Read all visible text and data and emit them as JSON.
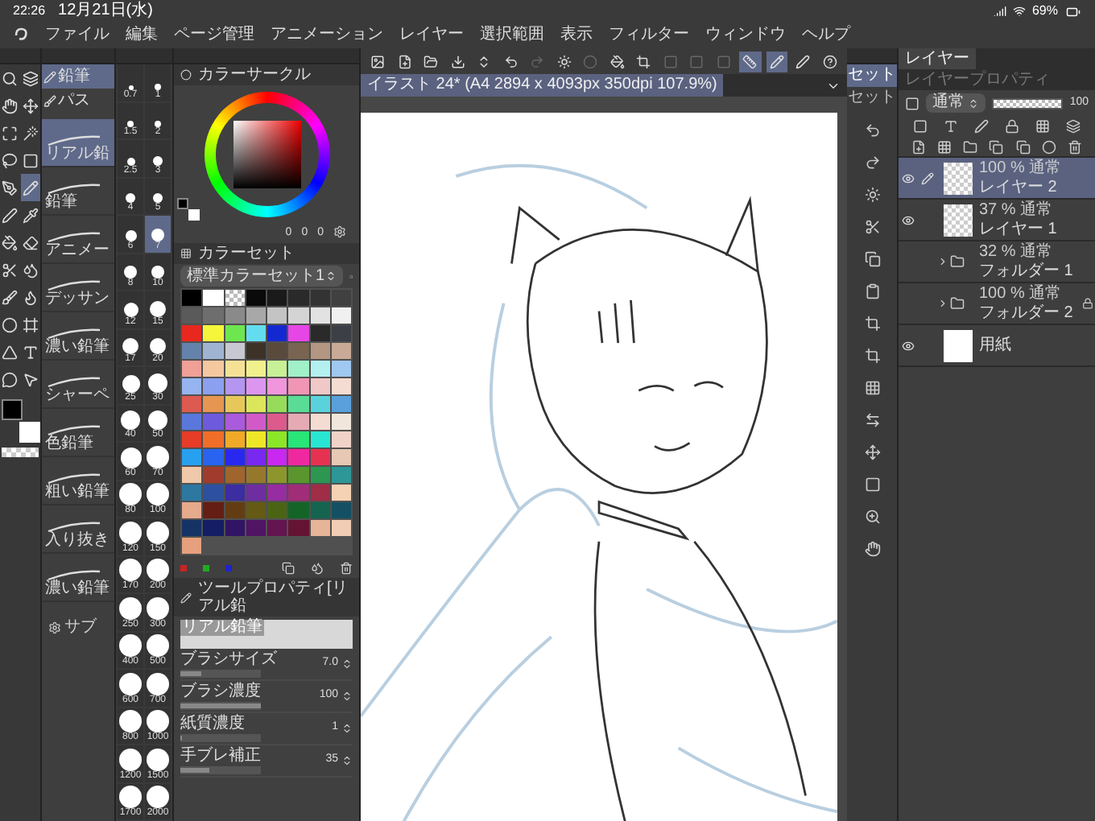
{
  "status_bar": {
    "time": "22:26",
    "date": "12月21日(水)",
    "battery": "69%"
  },
  "menu": [
    "ファイル",
    "編集",
    "ページ管理",
    "アニメーション",
    "レイヤー",
    "選択範囲",
    "表示",
    "フィルター",
    "ウィンドウ",
    "ヘルプ"
  ],
  "tools": [
    {
      "selected": false
    },
    {
      "selected": false
    },
    {
      "selected": false
    },
    {
      "selected": false
    },
    {
      "selected": false
    },
    {
      "selected": false
    },
    {
      "selected": false
    },
    {
      "selected": false
    },
    {
      "selected": false
    },
    {
      "selected": true
    },
    {
      "selected": false
    },
    {
      "selected": false
    },
    {
      "selected": false
    },
    {
      "selected": false
    },
    {
      "selected": false
    },
    {
      "selected": false
    },
    {
      "selected": false
    },
    {
      "selected": false
    },
    {
      "selected": false
    },
    {
      "selected": false
    },
    {
      "selected": false
    },
    {
      "selected": false
    },
    {
      "selected": false
    },
    {
      "selected": false
    }
  ],
  "subtool_groups": [
    {
      "label": "鉛筆",
      "selected": true
    },
    {
      "label": "パス",
      "selected": false
    }
  ],
  "subtools": [
    {
      "label": "リアル鉛",
      "selected": true
    },
    {
      "label": "鉛筆",
      "selected": false
    },
    {
      "label": "アニメー",
      "selected": false
    },
    {
      "label": "デッサン",
      "selected": false
    },
    {
      "label": "濃い鉛筆",
      "selected": false
    },
    {
      "label": "シャーペ",
      "selected": false
    },
    {
      "label": "色鉛筆",
      "selected": false
    },
    {
      "label": "粗い鉛筆",
      "selected": false
    },
    {
      "label": "入り抜き",
      "selected": false
    },
    {
      "label": "濃い鉛筆",
      "selected": false
    }
  ],
  "subtool_footer": "サブ",
  "brush_sizes": [
    {
      "label": "0.7",
      "selected": false
    },
    {
      "label": "1",
      "selected": false
    },
    {
      "label": "1.5",
      "selected": false
    },
    {
      "label": "2",
      "selected": false
    },
    {
      "label": "2.5",
      "selected": false
    },
    {
      "label": "3",
      "selected": false
    },
    {
      "label": "4",
      "selected": false
    },
    {
      "label": "5",
      "selected": false
    },
    {
      "label": "6",
      "selected": false
    },
    {
      "label": "7",
      "selected": true
    },
    {
      "label": "8",
      "selected": false
    },
    {
      "label": "10",
      "selected": false
    },
    {
      "label": "12",
      "selected": false
    },
    {
      "label": "15",
      "selected": false
    },
    {
      "label": "17",
      "selected": false
    },
    {
      "label": "20",
      "selected": false
    },
    {
      "label": "25",
      "selected": false
    },
    {
      "label": "30",
      "selected": false
    },
    {
      "label": "40",
      "selected": false
    },
    {
      "label": "50",
      "selected": false
    },
    {
      "label": "60",
      "selected": false
    },
    {
      "label": "70",
      "selected": false
    },
    {
      "label": "80",
      "selected": false
    },
    {
      "label": "100",
      "selected": false
    },
    {
      "label": "120",
      "selected": false
    },
    {
      "label": "150",
      "selected": false
    },
    {
      "label": "170",
      "selected": false
    },
    {
      "label": "200",
      "selected": false
    },
    {
      "label": "250",
      "selected": false
    },
    {
      "label": "300",
      "selected": false
    },
    {
      "label": "400",
      "selected": false
    },
    {
      "label": "500",
      "selected": false
    },
    {
      "label": "600",
      "selected": false
    },
    {
      "label": "700",
      "selected": false
    },
    {
      "label": "800",
      "selected": false
    },
    {
      "label": "1000",
      "selected": false
    },
    {
      "label": "1200",
      "selected": false
    },
    {
      "label": "1500",
      "selected": false
    },
    {
      "label": "1700",
      "selected": false
    },
    {
      "label": "2000",
      "selected": false
    }
  ],
  "color_circle": {
    "title": "カラーサークル",
    "values": [
      "0",
      "0",
      "0"
    ]
  },
  "color_set": {
    "title": "カラーセット",
    "set_name": "標準カラーセット1",
    "swatches": [
      {
        "kind": "solid",
        "color": "#000000"
      },
      {
        "kind": "solid",
        "color": "#ffffff"
      },
      {
        "kind": "transparent"
      },
      {
        "kind": "solid",
        "color": "#0a0a0a"
      },
      {
        "kind": "solid",
        "color": "#1a1a1a"
      },
      {
        "kind": "solid",
        "color": "#2a2a2a"
      },
      {
        "kind": "solid",
        "color": "#333333"
      },
      {
        "kind": "solid",
        "color": "#404040"
      },
      {
        "kind": "solid",
        "color": "#5a5a5a"
      },
      {
        "kind": "solid",
        "color": "#6e6e6e"
      },
      {
        "kind": "solid",
        "color": "#8a8a8a"
      },
      {
        "kind": "solid",
        "color": "#a8a8a8"
      },
      {
        "kind": "solid",
        "color": "#c4c4c4"
      },
      {
        "kind": "solid",
        "color": "#d4d4d4"
      },
      {
        "kind": "solid",
        "color": "#e2e2e2"
      },
      {
        "kind": "solid",
        "color": "#f0f0f0"
      },
      {
        "kind": "solid",
        "color": "#e8281e"
      },
      {
        "kind": "solid",
        "color": "#f5f53c"
      },
      {
        "kind": "solid",
        "color": "#6ee650"
      },
      {
        "kind": "solid",
        "color": "#64dcf0"
      },
      {
        "kind": "solid",
        "color": "#1428d2"
      },
      {
        "kind": "solid",
        "color": "#e646e6"
      },
      {
        "kind": "solid",
        "color": "#2a2a2a"
      },
      {
        "kind": "solid",
        "color": "#3c4046"
      },
      {
        "kind": "solid",
        "color": "#6482aa"
      },
      {
        "kind": "solid",
        "color": "#a0b4d2"
      },
      {
        "kind": "solid",
        "color": "#c8c8d2"
      },
      {
        "kind": "solid",
        "color": "#3c3228"
      },
      {
        "kind": "solid",
        "color": "#5a4a3c"
      },
      {
        "kind": "solid",
        "color": "#786450"
      },
      {
        "kind": "solid",
        "color": "#b49682"
      },
      {
        "kind": "solid",
        "color": "#c8aa96"
      },
      {
        "kind": "solid",
        "color": "#f0a096"
      },
      {
        "kind": "solid",
        "color": "#f5c8a0"
      },
      {
        "kind": "solid",
        "color": "#f5e196"
      },
      {
        "kind": "solid",
        "color": "#f0f08c"
      },
      {
        "kind": "solid",
        "color": "#c8f096"
      },
      {
        "kind": "solid",
        "color": "#a0f0c8"
      },
      {
        "kind": "solid",
        "color": "#b4f0f0"
      },
      {
        "kind": "solid",
        "color": "#a0c8f0"
      },
      {
        "kind": "solid",
        "color": "#96b4f0"
      },
      {
        "kind": "solid",
        "color": "#8ca0f0"
      },
      {
        "kind": "solid",
        "color": "#b496f0"
      },
      {
        "kind": "solid",
        "color": "#dc96f0"
      },
      {
        "kind": "solid",
        "color": "#f096dc"
      },
      {
        "kind": "solid",
        "color": "#f096b4"
      },
      {
        "kind": "solid",
        "color": "#f0c8c8"
      },
      {
        "kind": "solid",
        "color": "#f5dcd2"
      },
      {
        "kind": "solid",
        "color": "#dc5a50"
      },
      {
        "kind": "solid",
        "color": "#e69650"
      },
      {
        "kind": "solid",
        "color": "#e6c85a"
      },
      {
        "kind": "solid",
        "color": "#dce65a"
      },
      {
        "kind": "solid",
        "color": "#96dc5a"
      },
      {
        "kind": "solid",
        "color": "#5adc96"
      },
      {
        "kind": "solid",
        "color": "#5ad2dc"
      },
      {
        "kind": "solid",
        "color": "#5aa0dc"
      },
      {
        "kind": "solid",
        "color": "#5a78dc"
      },
      {
        "kind": "solid",
        "color": "#6e5adc"
      },
      {
        "kind": "solid",
        "color": "#aa5adc"
      },
      {
        "kind": "solid",
        "color": "#d25ac8"
      },
      {
        "kind": "solid",
        "color": "#dc5a8c"
      },
      {
        "kind": "solid",
        "color": "#e6aab4"
      },
      {
        "kind": "solid",
        "color": "#f5dcd2"
      },
      {
        "kind": "solid",
        "color": "#f0e6dc"
      },
      {
        "kind": "solid",
        "color": "#e63c28"
      },
      {
        "kind": "solid",
        "color": "#f06e28"
      },
      {
        "kind": "solid",
        "color": "#f0aa28"
      },
      {
        "kind": "solid",
        "color": "#f0e628"
      },
      {
        "kind": "solid",
        "color": "#8ce628"
      },
      {
        "kind": "solid",
        "color": "#28e678"
      },
      {
        "kind": "solid",
        "color": "#28e6d2"
      },
      {
        "kind": "solid",
        "color": "#f0d2c8"
      },
      {
        "kind": "solid",
        "color": "#28a0f0"
      },
      {
        "kind": "solid",
        "color": "#2864f0"
      },
      {
        "kind": "solid",
        "color": "#2828f0"
      },
      {
        "kind": "solid",
        "color": "#7828f0"
      },
      {
        "kind": "solid",
        "color": "#c828f0"
      },
      {
        "kind": "solid",
        "color": "#f028a0"
      },
      {
        "kind": "solid",
        "color": "#e63250"
      },
      {
        "kind": "solid",
        "color": "#e6c8b4"
      },
      {
        "kind": "solid",
        "color": "#f0c8aa"
      },
      {
        "kind": "solid",
        "color": "#a03c2d"
      },
      {
        "kind": "solid",
        "color": "#a0642d"
      },
      {
        "kind": "solid",
        "color": "#96782d"
      },
      {
        "kind": "solid",
        "color": "#8c962d"
      },
      {
        "kind": "solid",
        "color": "#5a962d"
      },
      {
        "kind": "solid",
        "color": "#2d9650"
      },
      {
        "kind": "solid",
        "color": "#2d9696"
      },
      {
        "kind": "solid",
        "color": "#2d78a0"
      },
      {
        "kind": "solid",
        "color": "#2d50a0"
      },
      {
        "kind": "solid",
        "color": "#3c2da0"
      },
      {
        "kind": "solid",
        "color": "#6e2da0"
      },
      {
        "kind": "solid",
        "color": "#962da0"
      },
      {
        "kind": "solid",
        "color": "#a02d78"
      },
      {
        "kind": "solid",
        "color": "#a02d46"
      },
      {
        "kind": "solid",
        "color": "#f5d2b4"
      },
      {
        "kind": "solid",
        "color": "#e6aa8c"
      },
      {
        "kind": "solid",
        "color": "#641e14"
      },
      {
        "kind": "solid",
        "color": "#643c14"
      },
      {
        "kind": "solid",
        "color": "#645a14"
      },
      {
        "kind": "solid",
        "color": "#4b6414"
      },
      {
        "kind": "solid",
        "color": "#146428"
      },
      {
        "kind": "solid",
        "color": "#146450"
      },
      {
        "kind": "solid",
        "color": "#145064"
      },
      {
        "kind": "solid",
        "color": "#143264"
      },
      {
        "kind": "solid",
        "color": "#141e64"
      },
      {
        "kind": "solid",
        "color": "#321464"
      },
      {
        "kind": "solid",
        "color": "#501464"
      },
      {
        "kind": "solid",
        "color": "#641450"
      },
      {
        "kind": "solid",
        "color": "#641432"
      },
      {
        "kind": "solid",
        "color": "#e6b496"
      },
      {
        "kind": "solid",
        "color": "#f0cdb4"
      },
      {
        "kind": "solid",
        "color": "#e6a07d"
      }
    ]
  },
  "tool_property": {
    "title": "ツールプロパティ[リアル鉛",
    "preview_label": "リアル鉛筆",
    "properties": [
      {
        "label": "ブラシサイズ",
        "value": "7.0",
        "level": 0.25
      },
      {
        "label": "ブラシ濃度",
        "value": "100",
        "level": 1
      },
      {
        "label": "紙質濃度",
        "value": "1",
        "level": 0.02
      },
      {
        "label": "手ブレ補正",
        "value": "35",
        "level": 0.35
      }
    ]
  },
  "toolbar": [
    {
      "selected": false,
      "disabled": false
    },
    {
      "selected": false,
      "disabled": false
    },
    {
      "selected": false,
      "disabled": false
    },
    {
      "selected": false,
      "disabled": false
    },
    {
      "selected": false,
      "disabled": false
    },
    {
      "selected": false,
      "disabled": false
    },
    {
      "selected": false,
      "disabled": true
    },
    {
      "selected": false,
      "disabled": false
    },
    {
      "selected": false,
      "disabled": true
    },
    {
      "selected": false,
      "disabled": false
    },
    {
      "selected": false,
      "disabled": false
    },
    {
      "selected": false,
      "disabled": true
    },
    {
      "selected": false,
      "disabled": true
    },
    {
      "selected": false,
      "disabled": true
    },
    {
      "selected": true,
      "disabled": false
    },
    {
      "selected": true,
      "disabled": false
    },
    {
      "selected": false,
      "disabled": false
    },
    {
      "selected": false,
      "disabled": false
    }
  ],
  "document_tab": "イラスト 24* (A4 2894 x 4093px 350dpi 107.9%)",
  "quick_access": [
    {
      "label": "セット",
      "selected": true
    },
    {
      "label": "セット",
      "selected": false
    }
  ],
  "layer_panel": {
    "tabs": [
      {
        "label": "レイヤー",
        "selected": true
      },
      {
        "label": "レイヤープロパティ",
        "selected": false
      }
    ],
    "blend_mode": "通常",
    "opacity": {
      "value": "100",
      "level": 1
    },
    "layers": [
      {
        "kind": "layer",
        "info": "100 % 通常",
        "name": "レイヤー 2",
        "selected": true,
        "visible": true,
        "locked": false
      },
      {
        "kind": "layer",
        "info": "37 % 通常",
        "name": "レイヤー 1",
        "selected": false,
        "visible": true,
        "locked": false
      },
      {
        "kind": "folder",
        "info": "32 % 通常",
        "name": "フォルダー 1",
        "selected": false,
        "visible": false,
        "locked": false
      },
      {
        "kind": "folder",
        "info": "100 % 通常",
        "name": "フォルダー 2",
        "selected": false,
        "visible": false,
        "locked": true
      },
      {
        "kind": "paper",
        "name": "用紙",
        "selected": false,
        "visible": true,
        "locked": false
      }
    ]
  }
}
